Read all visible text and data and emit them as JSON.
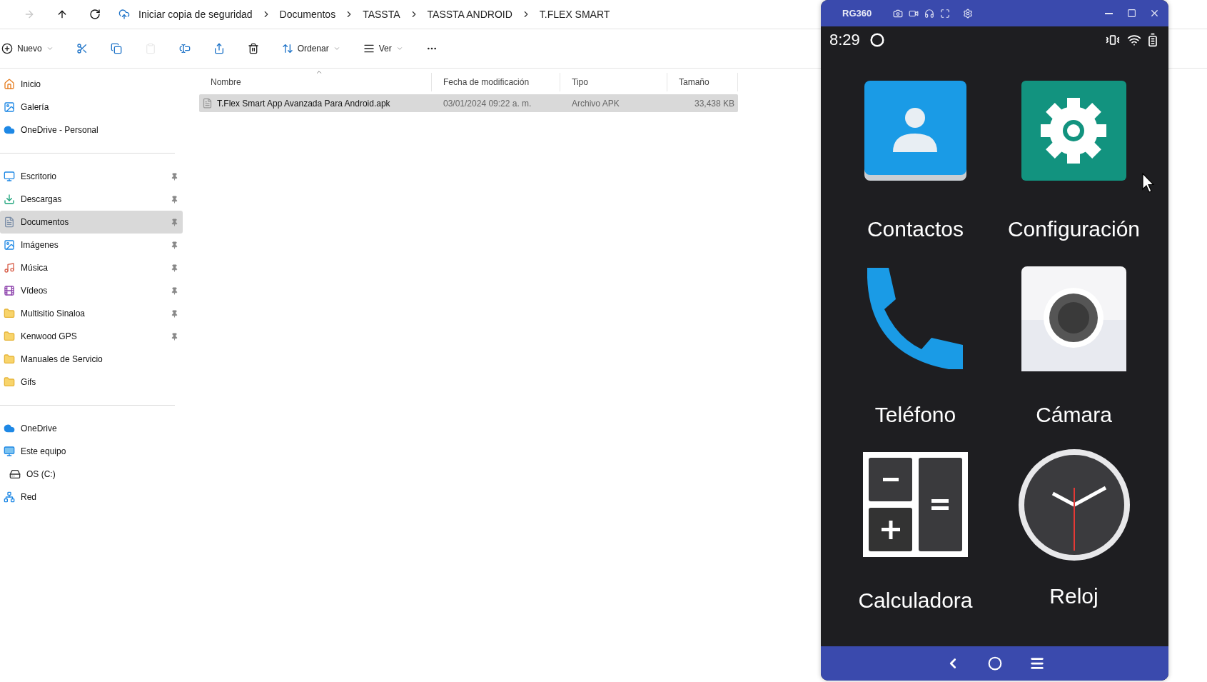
{
  "explorer": {
    "nav": [
      {
        "kind": "forward",
        "disabled": true
      },
      {
        "kind": "up",
        "disabled": false
      },
      {
        "kind": "refresh",
        "disabled": false
      }
    ],
    "breadcrumb": [
      "Iniciar copia de seguridad",
      "Documentos",
      "TASSTA",
      "TASSTA ANDROID",
      "T.FLEX SMART"
    ],
    "toolbar": [
      {
        "kind": "new",
        "label": "Nuevo",
        "disabled": false
      },
      {
        "kind": "cut",
        "disabled": false
      },
      {
        "kind": "copy",
        "disabled": false
      },
      {
        "kind": "paste",
        "disabled": true
      },
      {
        "kind": "rename",
        "disabled": false
      },
      {
        "kind": "share",
        "disabled": false
      },
      {
        "kind": "delete",
        "disabled": false
      },
      {
        "kind": "sort",
        "label": "Ordenar",
        "disabled": false
      },
      {
        "kind": "view",
        "label": "Ver",
        "disabled": false
      },
      {
        "kind": "more",
        "disabled": false
      }
    ],
    "sidebar": [
      [
        {
          "kind": "home",
          "label": "Inicio",
          "pinned": false,
          "selected": false
        },
        {
          "kind": "gallery",
          "label": "Galería",
          "pinned": false,
          "selected": false
        },
        {
          "kind": "cloud",
          "label": "OneDrive - Personal",
          "pinned": false,
          "selected": false
        }
      ],
      [
        {
          "kind": "desktop",
          "label": "Escritorio",
          "pinned": true,
          "selected": false
        },
        {
          "kind": "download",
          "label": "Descargas",
          "pinned": true,
          "selected": false
        },
        {
          "kind": "documents",
          "label": "Documentos",
          "pinned": true,
          "selected": true
        },
        {
          "kind": "pictures",
          "label": "Imágenes",
          "pinned": true,
          "selected": false
        },
        {
          "kind": "music",
          "label": "Música",
          "pinned": true,
          "selected": false
        },
        {
          "kind": "videos",
          "label": "Vídeos",
          "pinned": true,
          "selected": false
        },
        {
          "kind": "folder",
          "label": "Multisitio Sinaloa",
          "pinned": true,
          "selected": false
        },
        {
          "kind": "folder",
          "label": "Kenwood GPS",
          "pinned": true,
          "selected": false
        },
        {
          "kind": "folder",
          "label": "Manuales de Servicio",
          "pinned": false,
          "selected": false
        },
        {
          "kind": "folder",
          "label": "Gifs",
          "pinned": false,
          "selected": false
        }
      ],
      [
        {
          "kind": "cloud",
          "label": "OneDrive",
          "pinned": false,
          "selected": false
        },
        {
          "kind": "pc",
          "label": "Este equipo",
          "pinned": false,
          "selected": false
        },
        {
          "kind": "drive",
          "label": "OS (C:)",
          "pinned": false,
          "selected": false
        },
        {
          "kind": "network",
          "label": "Red",
          "pinned": false,
          "selected": false
        }
      ]
    ],
    "columns": [
      {
        "label": "Nombre",
        "sorted": true
      },
      {
        "label": "Fecha de modificación",
        "sorted": false
      },
      {
        "label": "Tipo",
        "sorted": false
      },
      {
        "label": "Tamaño",
        "sorted": false
      }
    ],
    "rows": [
      {
        "cells": [
          "T.Flex Smart App Avanzada Para Android.apk",
          "03/01/2024 09:22 a. m.",
          "Archivo APK",
          "33,438 KB"
        ],
        "selected": true
      }
    ]
  },
  "phone": {
    "title": "RG360",
    "time": "8:29",
    "apps": [
      {
        "kind": "contacts",
        "label": "Contactos"
      },
      {
        "kind": "settings",
        "label": "Configuración"
      },
      {
        "kind": "phone",
        "label": "Teléfono"
      },
      {
        "kind": "camera",
        "label": "Cámara"
      },
      {
        "kind": "calculator",
        "label": "Calculadora"
      },
      {
        "kind": "clock",
        "label": "Reloj"
      }
    ]
  }
}
